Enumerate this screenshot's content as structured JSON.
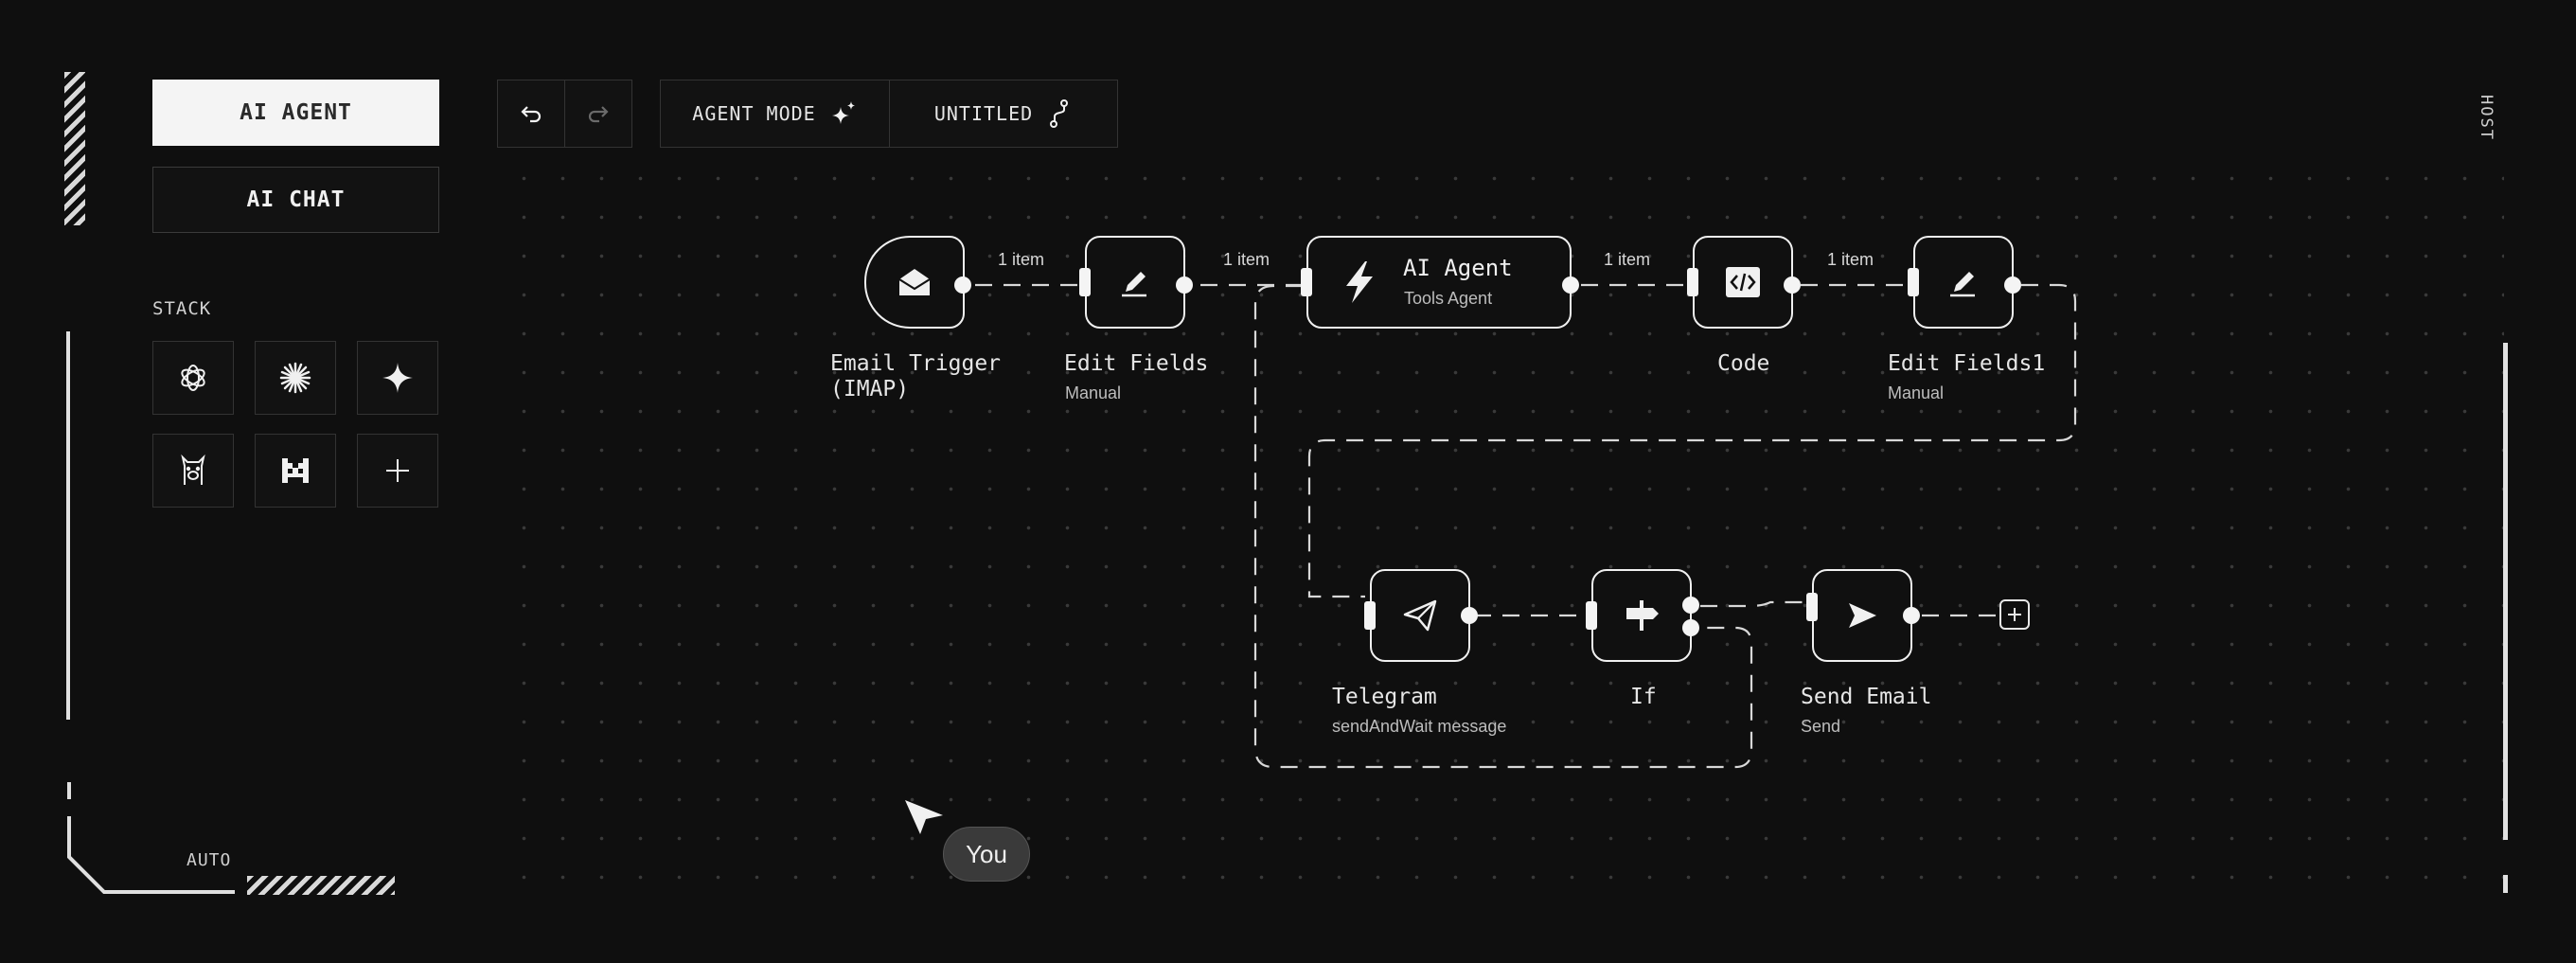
{
  "sidebar": {
    "primary_button": "AI AGENT",
    "secondary_button": "AI CHAT",
    "stack_label": "STACK",
    "stack_items": [
      {
        "name": "openai-icon"
      },
      {
        "name": "anthropic-icon"
      },
      {
        "name": "gemini-icon"
      },
      {
        "name": "llama-icon"
      },
      {
        "name": "mistral-icon"
      },
      {
        "name": "add-icon"
      }
    ],
    "auto_label": "AUTO"
  },
  "toolbar": {
    "agent_mode_label": "AGENT MODE",
    "untitled_label": "UNTITLED"
  },
  "host_label": "HOST",
  "workflow": {
    "nodes": [
      {
        "id": "email-trigger",
        "label": "Email Trigger\n(IMAP)",
        "sub": "",
        "icon": "envelope-icon"
      },
      {
        "id": "edit-fields",
        "label": "Edit Fields",
        "sub": "Manual",
        "icon": "pencil-icon"
      },
      {
        "id": "ai-agent",
        "label": "AI Agent",
        "sub": "Tools Agent",
        "icon": "lightning-icon"
      },
      {
        "id": "code",
        "label": "Code",
        "sub": "",
        "icon": "code-icon"
      },
      {
        "id": "edit-fields1",
        "label": "Edit Fields1",
        "sub": "Manual",
        "icon": "pencil-icon"
      },
      {
        "id": "telegram",
        "label": "Telegram",
        "sub": "sendAndWait message",
        "icon": "paper-plane-icon"
      },
      {
        "id": "if",
        "label": "If",
        "sub": "",
        "icon": "signpost-icon"
      },
      {
        "id": "send-email",
        "label": "Send Email",
        "sub": "Send",
        "icon": "send-icon"
      }
    ],
    "edge_labels": [
      "1 item",
      "1 item",
      "1 item",
      "1 item"
    ]
  },
  "cursor": {
    "label": "You"
  },
  "colors": {
    "background": "#0f0f0f",
    "node_border": "#f0f0f0",
    "accent_light": "#f4f4f4"
  }
}
